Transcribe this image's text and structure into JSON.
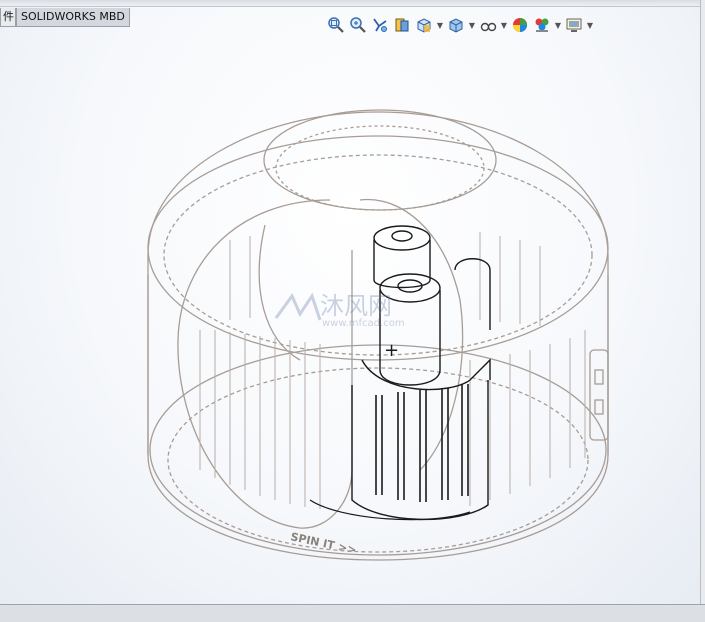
{
  "tabs": {
    "left_label": "件",
    "mbd_label": "SOLIDWORKS MBD"
  },
  "model": {
    "engraved_text": "SPIN IT >>",
    "battery_symbol": "+",
    "watermark_cn": "沐风网",
    "watermark_url": "www.mfcad.com"
  },
  "hud_icons": [
    "zoom-to-fit-icon",
    "zoom-to-area-icon",
    "previous-view-icon",
    "section-view-icon",
    "view-orientation-icon",
    "display-style-icon",
    "hide-show-items-icon",
    "edit-appearance-icon",
    "apply-scene-icon",
    "view-settings-icon"
  ],
  "colors": {
    "edge": "#a79d96",
    "dark_edge": "#1a1a1a",
    "viewport_bg": "#eef2f7"
  }
}
